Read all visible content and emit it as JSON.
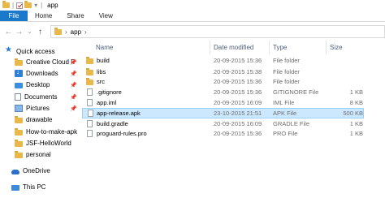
{
  "window": {
    "title": "app"
  },
  "ribbon": {
    "tabs": [
      "File",
      "Home",
      "Share",
      "View"
    ]
  },
  "address": {
    "path": [
      "app"
    ]
  },
  "nav": {
    "items": [
      {
        "label": "Quick access",
        "icon": "star-icon"
      },
      {
        "label": "Creative Cloud F",
        "icon": "folder-icon",
        "pinned": true
      },
      {
        "label": "Downloads",
        "icon": "download-icon",
        "pinned": true
      },
      {
        "label": "Desktop",
        "icon": "desktop-icon",
        "pinned": true
      },
      {
        "label": "Documents",
        "icon": "documents-icon",
        "pinned": true
      },
      {
        "label": "Pictures",
        "icon": "pictures-icon",
        "pinned": true
      },
      {
        "label": "drawable",
        "icon": "folder-icon"
      },
      {
        "label": "How-to-make-apk",
        "icon": "folder-icon"
      },
      {
        "label": "JSF-HelloWorld",
        "icon": "folder-icon"
      },
      {
        "label": "personal",
        "icon": "folder-icon"
      },
      {
        "label": "OneDrive",
        "icon": "onedrive-icon"
      },
      {
        "label": "This PC",
        "icon": "pc-icon"
      }
    ]
  },
  "columns": {
    "name": "Name",
    "date": "Date modified",
    "type": "Type",
    "size": "Size"
  },
  "files": [
    {
      "name": "build",
      "date": "20-09-2015 15:36",
      "type": "File folder",
      "size": "",
      "kind": "folder"
    },
    {
      "name": "libs",
      "date": "20-09-2015 15:38",
      "type": "File folder",
      "size": "",
      "kind": "folder"
    },
    {
      "name": "src",
      "date": "20-09-2015 15:36",
      "type": "File folder",
      "size": "",
      "kind": "folder"
    },
    {
      "name": ".gitignore",
      "date": "20-09-2015 15:36",
      "type": "GITIGNORE File",
      "size": "1 KB",
      "kind": "file"
    },
    {
      "name": "app.iml",
      "date": "20-09-2015 16:09",
      "type": "IML File",
      "size": "8 KB",
      "kind": "file"
    },
    {
      "name": "app-release.apk",
      "date": "23-10-2015 21:51",
      "type": "APK File",
      "size": "500 KB",
      "kind": "file",
      "selected": true
    },
    {
      "name": "build.gradle",
      "date": "20-09-2015 16:09",
      "type": "GRADLE File",
      "size": "1 KB",
      "kind": "file"
    },
    {
      "name": "proguard-rules.pro",
      "date": "20-09-2015 15:36",
      "type": "PRO File",
      "size": "1 KB",
      "kind": "file"
    }
  ],
  "colors": {
    "file_tab": "#1979ca",
    "selection": "#cce8ff",
    "selection_border": "#99d1ff",
    "folder": "#e8b94a"
  }
}
